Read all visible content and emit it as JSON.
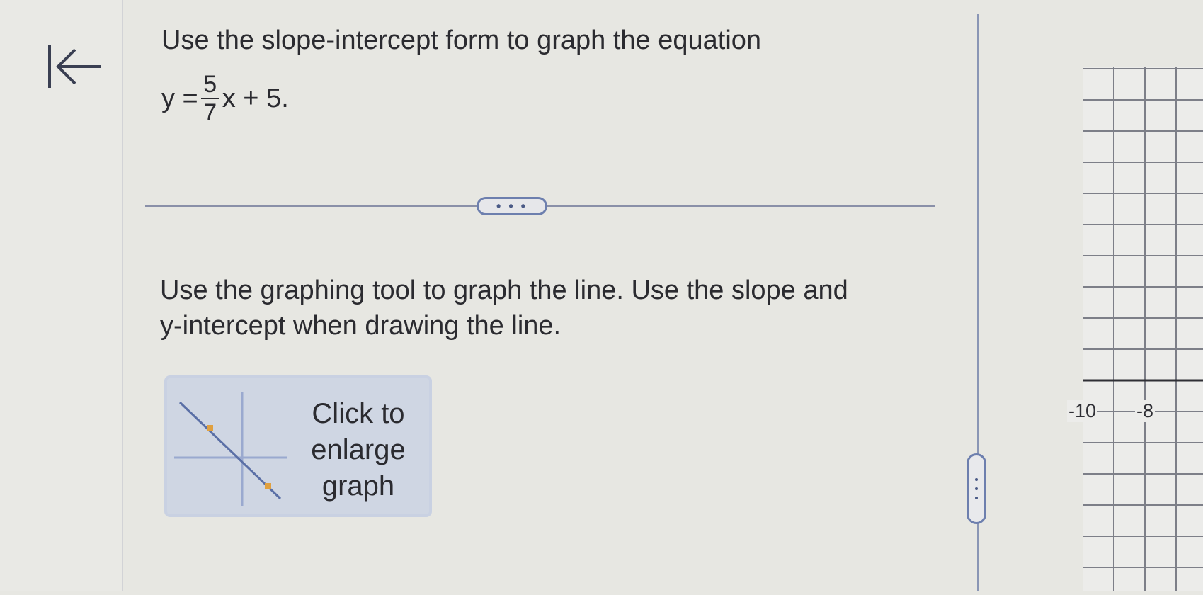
{
  "question": {
    "prompt": "Use the slope-intercept form to graph the equation",
    "equation": {
      "lhs": "y =",
      "numerator": "5",
      "denominator": "7",
      "rhs": "x + 5."
    }
  },
  "more_button_label": "• • •",
  "instructions": "Use the graphing tool to graph the line.  Use the slope and y-intercept when drawing the line.",
  "enlarge_button": {
    "line1": "Click to",
    "line2": "enlarge",
    "line3": "graph"
  },
  "graph": {
    "x_tick_labels": [
      "-10",
      "-8"
    ]
  },
  "icons": {
    "back": "back-to-start-icon",
    "splitter": "drag-handle-icon"
  },
  "colors": {
    "accent": "#6d7fae",
    "thumb_point": "#e0a040",
    "thumb_line": "#5a6fa6"
  }
}
